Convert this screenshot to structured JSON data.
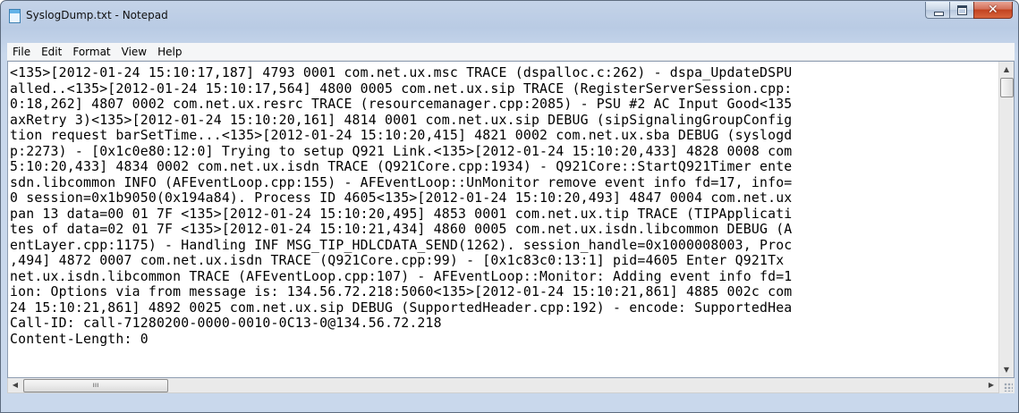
{
  "window": {
    "title": "SyslogDump.txt - Notepad",
    "icon": "notepad-icon"
  },
  "caption_buttons": {
    "minimize": "minimize-icon",
    "maximize": "maximize-icon",
    "close": "close-icon"
  },
  "menu": {
    "items": [
      "File",
      "Edit",
      "Format",
      "View",
      "Help"
    ]
  },
  "editor": {
    "lines": [
      "<135>[2012-01-24 15:10:17,187] 4793 0001 com.net.ux.msc TRACE (dspalloc.c:262) - dspa_UpdateDSPU",
      "alled..<135>[2012-01-24 15:10:17,564] 4800 0005 com.net.ux.sip TRACE (RegisterServerSession.cpp:",
      "0:18,262] 4807 0002 com.net.ux.resrc TRACE (resourcemanager.cpp:2085) - PSU #2 AC Input Good<135",
      "axRetry 3)<135>[2012-01-24 15:10:20,161] 4814 0001 com.net.ux.sip DEBUG (sipSignalingGroupConfig",
      "tion request barSetTime...<135>[2012-01-24 15:10:20,415] 4821 0002 com.net.ux.sba DEBUG (syslogd",
      "p:2273) - [0x1c0e80:12:0] Trying to setup Q921 Link.<135>[2012-01-24 15:10:20,433] 4828 0008 com",
      "5:10:20,433] 4834 0002 com.net.ux.isdn TRACE (Q921Core.cpp:1934) - Q921Core::StartQ921Timer ente",
      "sdn.libcommon INFO (AFEventLoop.cpp:155) - AFEventLoop::UnMonitor remove event info fd=17, info=",
      "0 session=0x1b9050(0x194a84). Process ID 4605<135>[2012-01-24 15:10:20,493] 4847 0004 com.net.ux",
      "pan 13 data=00 01 7F <135>[2012-01-24 15:10:20,495] 4853 0001 com.net.ux.tip TRACE (TIPApplicati",
      "tes of data=02 01 7F <135>[2012-01-24 15:10:21,434] 4860 0005 com.net.ux.isdn.libcommon DEBUG (A",
      "entLayer.cpp:1175) - Handling INF MSG_TIP_HDLCDATA_SEND(1262). session_handle=0x1000008003, Proc",
      ",494] 4872 0007 com.net.ux.isdn TRACE (Q921Core.cpp:99) - [0x1c83c0:13:1] pid=4605 Enter Q921Tx",
      "net.ux.isdn.libcommon TRACE (AFEventLoop.cpp:107) - AFEventLoop::Monitor: Adding event info fd=1",
      "ion: Options via from message is: 134.56.72.218:5060<135>[2012-01-24 15:10:21,861] 4885 002c com",
      "24 15:10:21,861] 4892 0025 com.net.ux.sip DEBUG (SupportedHeader.cpp:192) - encode: SupportedHea",
      "Call-ID: call-71280200-0000-0010-0C13-0@134.56.72.218",
      "Content-Length: 0"
    ]
  },
  "scrollbars": {
    "vertical_up": "scroll-up-arrow-icon",
    "vertical_down": "scroll-down-arrow-icon",
    "horizontal_left": "scroll-left-arrow-icon",
    "horizontal_right": "scroll-right-arrow-icon",
    "horizontal_thumb_grip": "ııı"
  }
}
